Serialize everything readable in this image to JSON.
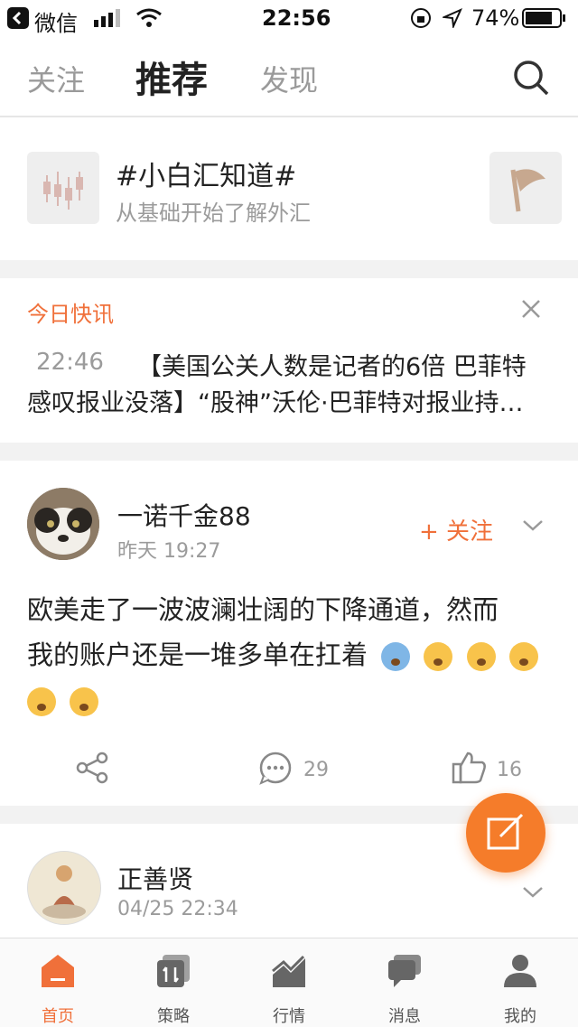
{
  "status_bar": {
    "back_app": "微信",
    "time": "22:56",
    "battery": "74%"
  },
  "header": {
    "tabs": [
      "关注",
      "推荐",
      "发现"
    ],
    "active_tab": 1
  },
  "topic_strip": {
    "items": [
      {
        "title": "#小白汇知道#",
        "subtitle": "从基础开始了解外汇",
        "icon": "candlestick-icon"
      },
      {
        "title": "",
        "subtitle": "",
        "icon": "flag-icon"
      }
    ]
  },
  "flash_news": {
    "label": "今日快讯",
    "time": "22:46",
    "line1": "【美国公关人数是记者的6倍 巴菲特",
    "line2": "感叹报业没落】“股神”沃伦·巴菲特对报业持…"
  },
  "posts": [
    {
      "author": "一诺千金88",
      "time": "昨天 19:27",
      "follow_label": "+ 关注",
      "text_line1": "欧美走了一波波澜壮阔的下降通道，然而",
      "text_line2": "我的账户还是一堆多单在扛着",
      "comments": "29",
      "likes": "16"
    },
    {
      "author": "正善贤",
      "time": "04/25 22:34"
    }
  ],
  "tab_bar": {
    "items": [
      {
        "label": "首页",
        "icon": "home-icon"
      },
      {
        "label": "策略",
        "icon": "strategy-icon"
      },
      {
        "label": "行情",
        "icon": "chart-icon"
      },
      {
        "label": "消息",
        "icon": "message-icon"
      },
      {
        "label": "我的",
        "icon": "profile-icon"
      }
    ],
    "active": 0
  },
  "colors": {
    "accent": "#f0703a",
    "fab": "#f57c2a"
  }
}
